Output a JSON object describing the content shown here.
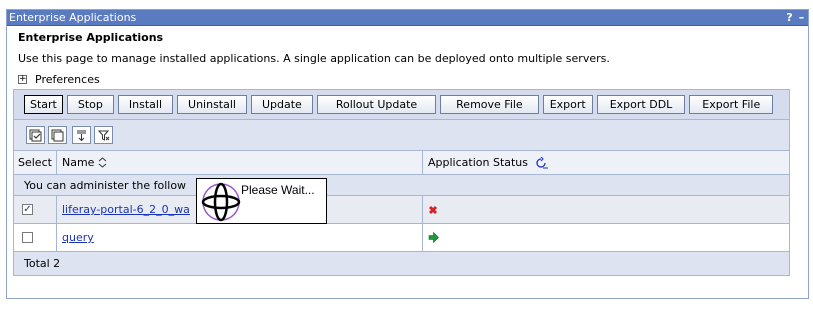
{
  "window": {
    "title": "Enterprise Applications",
    "help_icon": "?",
    "minimize_icon": "–"
  },
  "page": {
    "title": "Enterprise Applications",
    "description": "Use this page to manage installed applications. A single application can be deployed onto multiple servers.",
    "preferences_label": "Preferences",
    "preferences_expander": "+"
  },
  "buttons": [
    "Start",
    "Stop",
    "Install",
    "Uninstall",
    "Update",
    "Rollout Update",
    "Remove File",
    "Export",
    "Export DDL",
    "Export File"
  ],
  "icons": [
    "select-all-icon",
    "deselect-all-icon",
    "show-filter-icon",
    "clear-filter-icon"
  ],
  "table": {
    "headers": {
      "select": "Select",
      "name": "Name",
      "status": "Application Status"
    },
    "info_text": "You can administer the follow",
    "rows": [
      {
        "name": "liferay-portal-6_2_0_wa",
        "checked": true,
        "status": "stopped"
      },
      {
        "name": "query",
        "checked": false,
        "status": "started"
      }
    ],
    "total": "Total 2"
  },
  "overlay": {
    "text": "Please Wait..."
  },
  "colors": {
    "titlebar": "#5a7bbf",
    "stopped": "#d8202a",
    "started": "#1d9a3a",
    "link": "#1a33b8"
  }
}
